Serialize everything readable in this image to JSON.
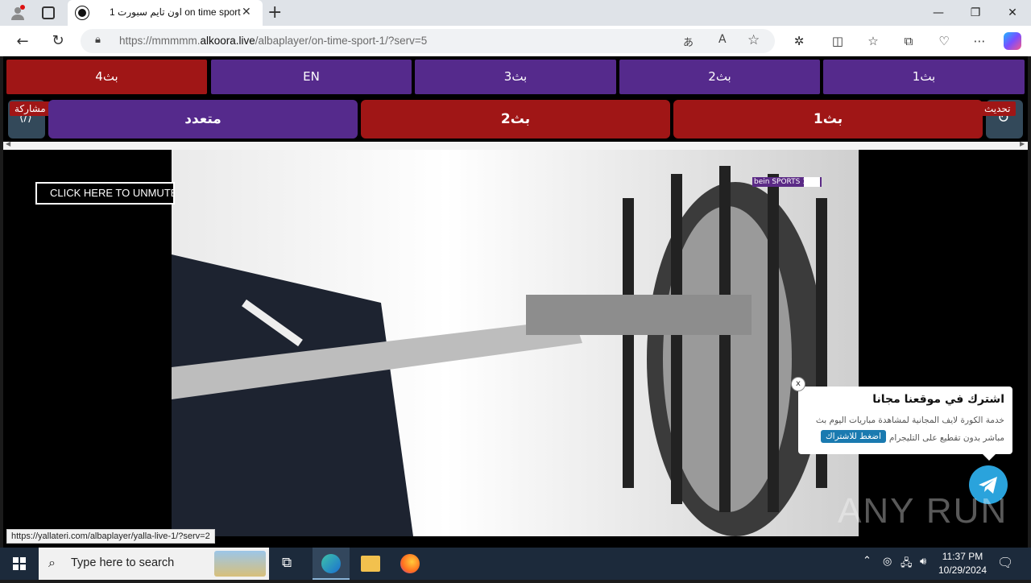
{
  "browser": {
    "tab_title": "اون تايم سبورت 1 on time sport",
    "url_prefix": "https://mmmmm.",
    "url_host": "alkoora.live",
    "url_path": "/albaplayer/on-time-sport-1/?serv=5",
    "status_url": "https://yallateri.com/albaplayer/yalla-live-1/?serv=2"
  },
  "servers": {
    "row1": [
      {
        "label": "بث4",
        "color": "red"
      },
      {
        "label": "EN",
        "color": "purple"
      },
      {
        "label": "بث3",
        "color": "purple"
      },
      {
        "label": "بث2",
        "color": "purple"
      },
      {
        "label": "بث1",
        "color": "purple"
      }
    ],
    "row2": [
      {
        "label": "متعدد",
        "color": "purple"
      },
      {
        "label": "بث2",
        "color": "red"
      },
      {
        "label": "بث1",
        "color": "red"
      }
    ],
    "share_label": "مشاركة",
    "refresh_label": "تحديث"
  },
  "video": {
    "unmute_label": "CLICK HERE TO UNMUTE",
    "channel_logo": "bein SPORTS 1"
  },
  "popup": {
    "title": "اشترك في موقعنا مجانا",
    "line1": "خدمة الكورة لايف المجانية لمشاهدة مباريات اليوم بث",
    "line2": "مباشر بدون تقطيع على التليجرام",
    "button": "اضغط للاشتراك",
    "close": "x"
  },
  "watermark": "ANY RUN",
  "taskbar": {
    "search_placeholder": "Type here to search",
    "time": "11:37 PM",
    "date": "10/29/2024"
  },
  "colors": {
    "purple": "#552a8c",
    "red": "#a01616",
    "telegram": "#2aa3dc"
  }
}
